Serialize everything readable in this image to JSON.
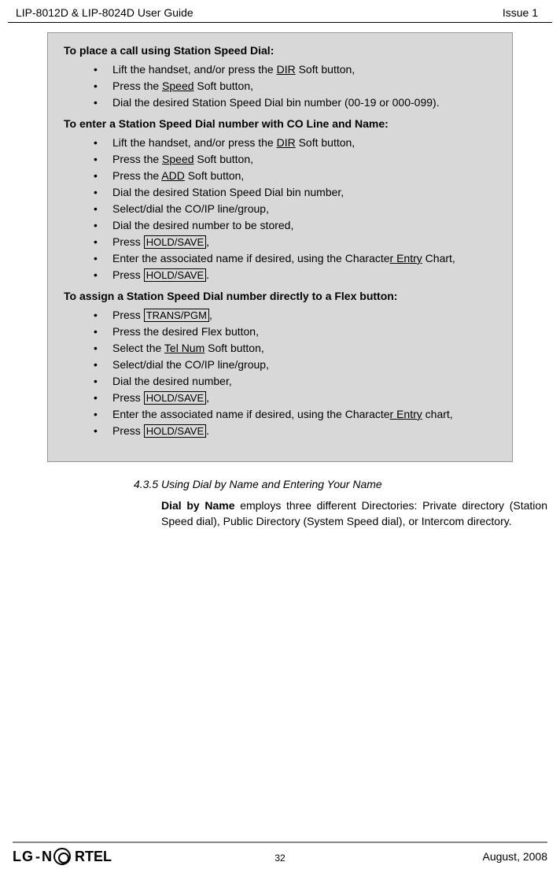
{
  "header": {
    "left": "LIP-8012D & LIP-8024D User Guide",
    "right": "Issue 1"
  },
  "sections": {
    "s1_title": "To place a call using Station Speed Dial:",
    "s1_items": {
      "i0a": "Lift the handset, and/or press the ",
      "i0b": "DIR",
      "i0c": " Soft button,",
      "i1a": "Press the ",
      "i1b": "Speed",
      "i1c": " Soft button,",
      "i2": "Dial the desired Station Speed Dial bin number (00-19 or 000-099)."
    },
    "s2_title": "To enter a Station Speed Dial number with CO Line and Name:",
    "s2_items": {
      "i0a": "Lift the handset, and/or press the ",
      "i0b": "DIR",
      "i0c": " Soft button,",
      "i1a": "Press the ",
      "i1b": "Speed",
      "i1c": " Soft button,",
      "i2a": "Press the ",
      "i2b": "ADD",
      "i2c": " Soft button,",
      "i3": "Dial the desired Station Speed Dial bin number,",
      "i4": "Select/dial the CO/IP line/group,",
      "i5": "Dial the desired number to be stored,",
      "i6a": "Press ",
      "i6b": "HOLD/SAVE",
      "i6c": ",",
      "i7a": "Enter the associated name if desired, using the Characte",
      "i7b": "r Entry",
      "i7c": " Chart,",
      "i8a": "Press ",
      "i8b": "HOLD/SAVE",
      "i8c": "."
    },
    "s3_title": "To assign a Station Speed Dial number directly to a Flex button:",
    "s3_items": {
      "i0a": "Press ",
      "i0b": "TRANS/PGM",
      "i0c": ",",
      "i1": "Press the desired Flex button,",
      "i2a": "Select the ",
      "i2b": "Tel Num",
      "i2c": " Soft button,",
      "i3": "Select/dial the CO/IP line/group,",
      "i4": "Dial the desired number,",
      "i5a": "Press ",
      "i5b": "HOLD/SAVE",
      "i5c": ",",
      "i6a": "Enter the associated name if desired, using the Characte",
      "i6b": "r Entry",
      "i6c": " chart,",
      "i7a": "Press ",
      "i7b": "HOLD/SAVE",
      "i7c": "."
    }
  },
  "subsection": {
    "number": "4.3.5",
    "title": "Using Dial by Name and Entering Your Name",
    "body_bold": "Dial by Name",
    "body_rest": " employs three different Directories: Private directory (Station Speed dial), Public Directory (System Speed dial), or Intercom directory."
  },
  "footer": {
    "logo_lg": "LG",
    "logo_nortel": "RTEL",
    "page": "32",
    "date": "August, 2008"
  }
}
